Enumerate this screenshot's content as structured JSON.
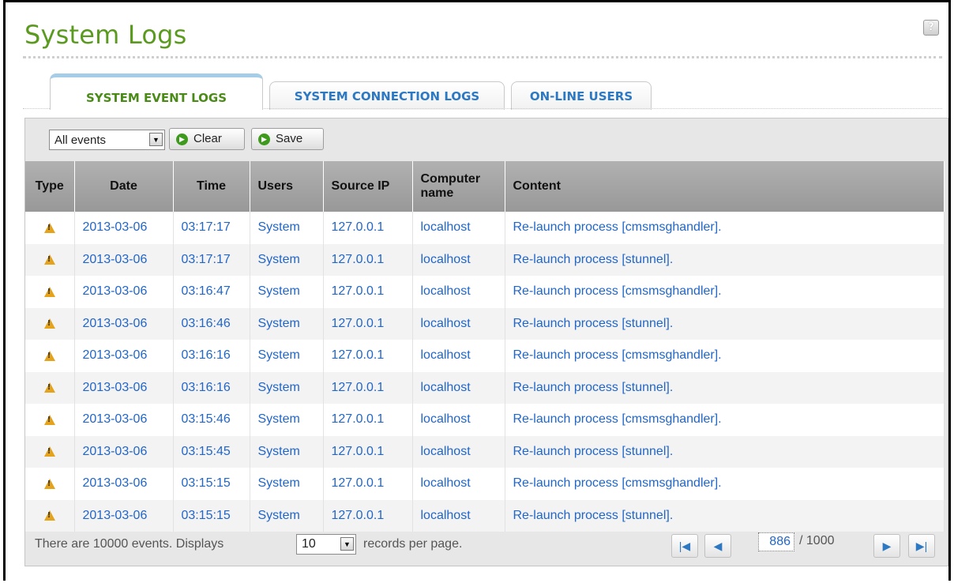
{
  "page": {
    "title": "System Logs"
  },
  "tabs": [
    {
      "label": "SYSTEM EVENT LOGS",
      "active": true
    },
    {
      "label": "SYSTEM CONNECTION LOGS",
      "active": false
    },
    {
      "label": "ON-LINE USERS",
      "active": false
    }
  ],
  "toolbar": {
    "filter_value": "All events",
    "clear_label": "Clear",
    "save_label": "Save"
  },
  "table": {
    "headers": [
      "Type",
      "Date",
      "Time",
      "Users",
      "Source IP",
      "Computer name",
      "Content"
    ],
    "rows": [
      {
        "type": "warning-icon",
        "date": "2013-03-06",
        "time": "03:17:17",
        "user": "System",
        "ip": "127.0.0.1",
        "computer": "localhost",
        "content": "Re-launch process [cmsmsghandler]."
      },
      {
        "type": "warning-icon",
        "date": "2013-03-06",
        "time": "03:17:17",
        "user": "System",
        "ip": "127.0.0.1",
        "computer": "localhost",
        "content": "Re-launch process [stunnel]."
      },
      {
        "type": "warning-icon",
        "date": "2013-03-06",
        "time": "03:16:47",
        "user": "System",
        "ip": "127.0.0.1",
        "computer": "localhost",
        "content": "Re-launch process [cmsmsghandler]."
      },
      {
        "type": "warning-icon",
        "date": "2013-03-06",
        "time": "03:16:46",
        "user": "System",
        "ip": "127.0.0.1",
        "computer": "localhost",
        "content": "Re-launch process [stunnel]."
      },
      {
        "type": "warning-icon",
        "date": "2013-03-06",
        "time": "03:16:16",
        "user": "System",
        "ip": "127.0.0.1",
        "computer": "localhost",
        "content": "Re-launch process [cmsmsghandler]."
      },
      {
        "type": "warning-icon",
        "date": "2013-03-06",
        "time": "03:16:16",
        "user": "System",
        "ip": "127.0.0.1",
        "computer": "localhost",
        "content": "Re-launch process [stunnel]."
      },
      {
        "type": "warning-icon",
        "date": "2013-03-06",
        "time": "03:15:46",
        "user": "System",
        "ip": "127.0.0.1",
        "computer": "localhost",
        "content": "Re-launch process [cmsmsghandler]."
      },
      {
        "type": "warning-icon",
        "date": "2013-03-06",
        "time": "03:15:45",
        "user": "System",
        "ip": "127.0.0.1",
        "computer": "localhost",
        "content": "Re-launch process [stunnel]."
      },
      {
        "type": "warning-icon",
        "date": "2013-03-06",
        "time": "03:15:15",
        "user": "System",
        "ip": "127.0.0.1",
        "computer": "localhost",
        "content": "Re-launch process [cmsmsghandler]."
      },
      {
        "type": "warning-icon",
        "date": "2013-03-06",
        "time": "03:15:15",
        "user": "System",
        "ip": "127.0.0.1",
        "computer": "localhost",
        "content": "Re-launch process [stunnel]."
      }
    ]
  },
  "footer": {
    "prefix": "There are 10000 events. Displays",
    "per_page": "10",
    "suffix": "records per page.",
    "current_page": "886",
    "total_pages": "/ 1000"
  },
  "icons": {
    "help": "help-icon",
    "first": "first-page-icon",
    "prev": "previous-page-icon",
    "next": "next-page-icon",
    "last": "last-page-icon"
  },
  "colors": {
    "title": "#5a9a1e",
    "link": "#2166c8",
    "tab_active": "#4a8b17",
    "tab_inactive": "#2c78c2",
    "warning": "#e4a31a"
  }
}
